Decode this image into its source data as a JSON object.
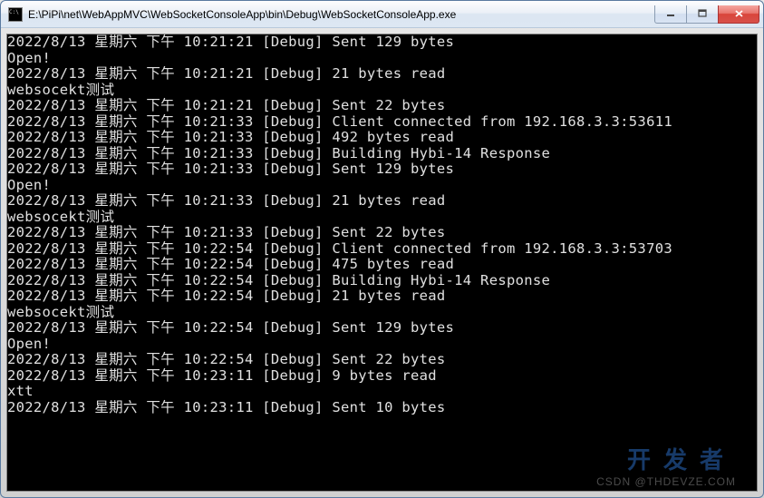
{
  "window": {
    "title": "E:\\PiPi\\net\\WebAppMVC\\WebSocketConsoleApp\\bin\\Debug\\WebSocketConsoleApp.exe"
  },
  "console_lines": [
    "2022/8/13 星期六 下午 10:21:21 [Debug] Sent 129 bytes",
    "Open!",
    "2022/8/13 星期六 下午 10:21:21 [Debug] 21 bytes read",
    "websocekt测试",
    "2022/8/13 星期六 下午 10:21:21 [Debug] Sent 22 bytes",
    "2022/8/13 星期六 下午 10:21:33 [Debug] Client connected from 192.168.3.3:53611",
    "2022/8/13 星期六 下午 10:21:33 [Debug] 492 bytes read",
    "2022/8/13 星期六 下午 10:21:33 [Debug] Building Hybi-14 Response",
    "2022/8/13 星期六 下午 10:21:33 [Debug] Sent 129 bytes",
    "Open!",
    "2022/8/13 星期六 下午 10:21:33 [Debug] 21 bytes read",
    "websocekt测试",
    "2022/8/13 星期六 下午 10:21:33 [Debug] Sent 22 bytes",
    "2022/8/13 星期六 下午 10:22:54 [Debug] Client connected from 192.168.3.3:53703",
    "2022/8/13 星期六 下午 10:22:54 [Debug] 475 bytes read",
    "2022/8/13 星期六 下午 10:22:54 [Debug] Building Hybi-14 Response",
    "2022/8/13 星期六 下午 10:22:54 [Debug] 21 bytes read",
    "websocekt测试",
    "2022/8/13 星期六 下午 10:22:54 [Debug] Sent 129 bytes",
    "Open!",
    "2022/8/13 星期六 下午 10:22:54 [Debug] Sent 22 bytes",
    "2022/8/13 星期六 下午 10:23:11 [Debug] 9 bytes read",
    "xtt",
    "2022/8/13 星期六 下午 10:23:11 [Debug] Sent 10 bytes"
  ],
  "watermark": {
    "line1": "开发者",
    "line2": "CSDN @THDEVZE.COM"
  }
}
